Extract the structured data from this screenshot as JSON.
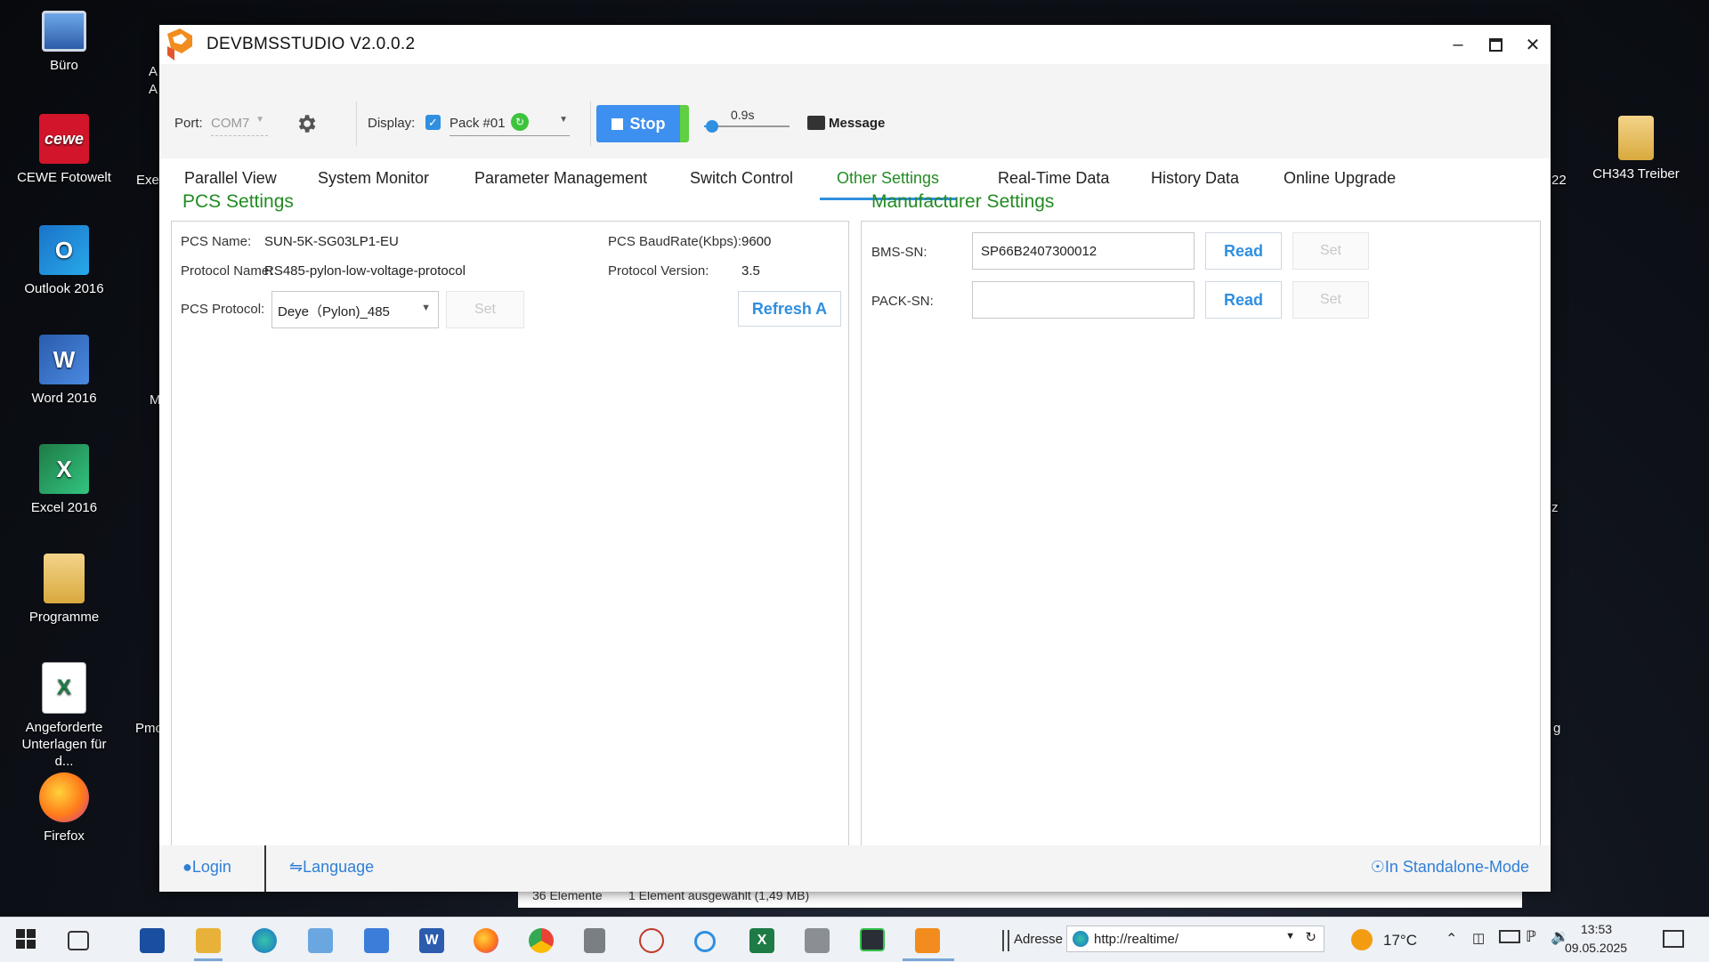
{
  "desktop": {
    "left_icons": [
      {
        "label": "Büro",
        "icon": "computer-icon",
        "color": "#4a7fc8"
      },
      {
        "label": "CEWE Fotowelt",
        "icon": "cewe-icon",
        "color": "#d2152a"
      },
      {
        "label": "Outlook 2016",
        "icon": "outlook-icon",
        "color": "#1a73c8"
      },
      {
        "label": "Word 2016",
        "icon": "word-icon",
        "color": "#2b5cad"
      },
      {
        "label": "Excel 2016",
        "icon": "excel-icon",
        "color": "#1e7b45"
      },
      {
        "label": "Programme",
        "icon": "folder-icon",
        "color": "#e8c264"
      },
      {
        "label": "Angeforderte Unterlagen für d...",
        "icon": "excel-file-icon",
        "color": "#1e7b45"
      },
      {
        "label": "Firefox",
        "icon": "firefox-icon",
        "color": "#ff7a1a"
      }
    ],
    "partial_labels": [
      "A",
      "A",
      "Exe",
      "M",
      "Pmc",
      "22",
      "z",
      "g"
    ],
    "right_icon": {
      "label": "CH343 Treiber",
      "icon": "folder-icon",
      "color": "#e8c264"
    }
  },
  "window": {
    "title": "DEVBMSSTUDIO V2.0.0.2",
    "toolbar": {
      "port_label": "Port:",
      "port_value": "COM7",
      "display_label": "Display:",
      "pack_value": "Pack #01",
      "stop_label": "Stop",
      "interval_value": "0.9s",
      "message_label": "Message"
    },
    "tabs": [
      {
        "label": "Parallel View",
        "active": false
      },
      {
        "label": "System Monitor",
        "active": false
      },
      {
        "label": "Parameter Management",
        "active": false
      },
      {
        "label": "Switch Control",
        "active": false
      },
      {
        "label": "Other Settings",
        "active": true
      },
      {
        "label": "Real-Time Data",
        "active": false
      },
      {
        "label": "History Data",
        "active": false
      },
      {
        "label": "Online Upgrade",
        "active": false
      }
    ],
    "pcs": {
      "title": "PCS Settings",
      "name_label": "PCS Name:",
      "name_value": "SUN-5K-SG03LP1-EU",
      "baud_label": "PCS BaudRate(Kbps):",
      "baud_value": "9600",
      "protocol_name_label": "Protocol Name:",
      "protocol_name_value": "RS485-pylon-low-voltage-protocol",
      "protocol_version_label": "Protocol Version:",
      "protocol_version_value": "3.5",
      "protocol_label": "PCS Protocol:",
      "protocol_selected": "Deye（Pylon)_485",
      "set_label": "Set",
      "refresh_label": "Refresh A"
    },
    "manufacturer": {
      "title": "Manufacturer Settings",
      "bms_sn_label": "BMS-SN:",
      "bms_sn_value": "SP66B2407300012",
      "pack_sn_label": "PACK-SN:",
      "pack_sn_value": "",
      "read_label": "Read",
      "set_label": "Set"
    },
    "status": {
      "login_label": "Login",
      "language_label": "Language",
      "mode_label": "In Standalone-Mode"
    }
  },
  "explorer": {
    "items_count": "36 Elemente",
    "selected": "1 Element ausgewählt (1,49 MB)"
  },
  "taskbar": {
    "address_label": "Adresse",
    "address_value": "http://realtime/",
    "temperature": "17°C",
    "time": "13:53",
    "date": "09.05.2025"
  },
  "colors": {
    "accent_green": "#228b22",
    "accent_blue": "#2f8fe0",
    "stop_blue": "#3d8ff0",
    "stop_green": "#5fd041"
  }
}
